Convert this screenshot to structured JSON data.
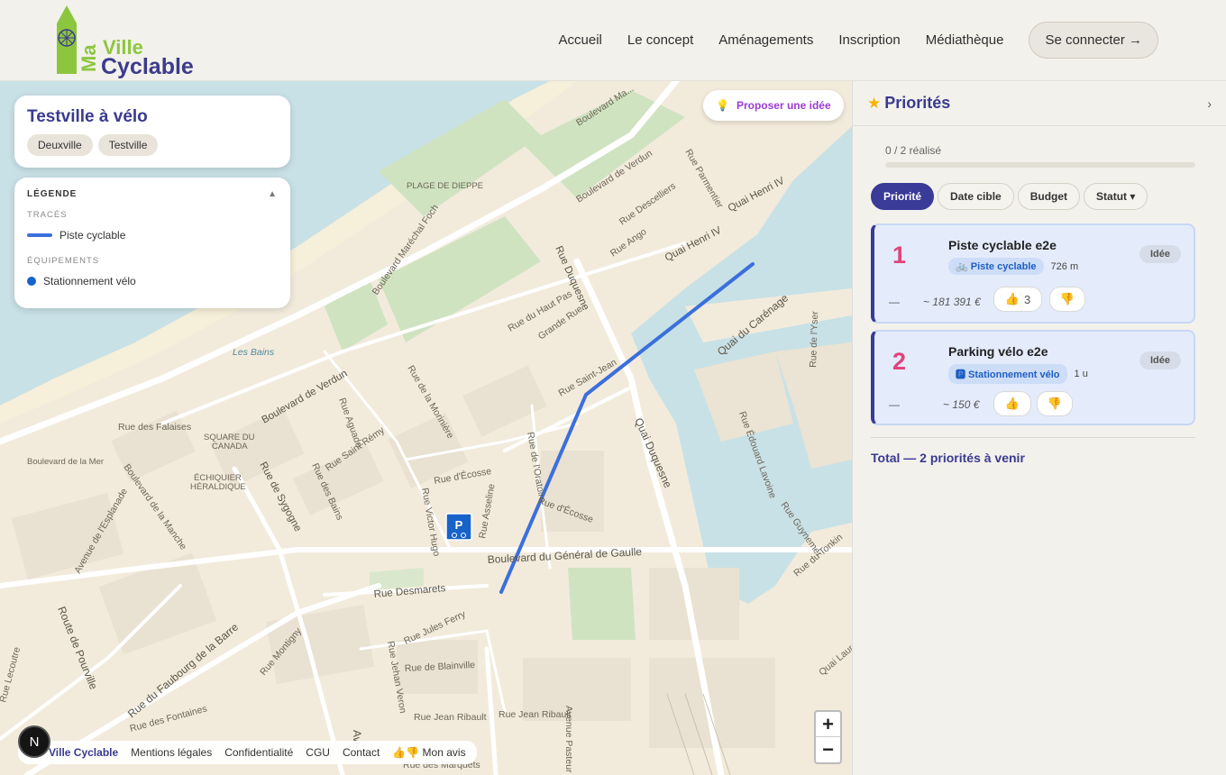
{
  "header": {
    "logo": {
      "ma": "Ma",
      "ville": "Ville",
      "cyclable": "Cyclable"
    },
    "nav": [
      "Accueil",
      "Le concept",
      "Aménagements",
      "Inscription",
      "Médiathèque"
    ],
    "connect_label": "Se connecter →"
  },
  "map": {
    "title": "Testville à vélo",
    "chips": [
      "Deuxville",
      "Testville"
    ],
    "legend": {
      "heading": "LÉGENDE",
      "toggle": "▲",
      "section_traces": "TRACÉS",
      "trace_label": "Piste cyclable",
      "section_equipements": "ÉQUIPEMENTS",
      "equipement_label": "Stationnement vélo"
    },
    "idea_button": "Proposer une idée",
    "labels": {
      "bd_maritime": "Boulevard Ma...",
      "bd_verdun_top": "Boulevard de Verdun",
      "bd_foch": "Boulevard Maréchal Foch",
      "plage": "PLAGE DE DIEPPE",
      "quai_henri": "Quai Henri IV",
      "quai_henri2": "Quai Henri IV",
      "rue_duquesne": "Rue Duquesne",
      "quai_duquesne": "Quai Duquesne",
      "quai_carenage": "Quai du Carénage",
      "bd_verdun": "Boulevard de Verdun",
      "les_bains": "Les Bains",
      "square": "SQUARE DU",
      "canada": "CANADA",
      "echiquier": "ÉCHIQUIER",
      "heraldique": "HÉRALDIQUE",
      "bd_mer": "Boulevard de la Mer",
      "rue_sygogne": "Rue de Sygogne",
      "rue_desmarets": "Rue Desmarets",
      "bd_gaulle": "Boulevard du Général de Gaulle",
      "route_pourville": "Route de Pourville",
      "rue_faubourg": "Rue du Faubourg de la Barre",
      "rue_ecosse": "Rue d'Écosse",
      "rue_ecosse2": "Rue d'Écosse",
      "grande_rue": "Grande Rue",
      "rue_haut_pas": "Rue du Haut Pas",
      "rue_saint_jean": "Rue Saint-Jean",
      "rue_saint_remy": "Rue Saint-Rémy",
      "rue_falaises": "Rue des Falaises",
      "rue_blainville": "Rue de Blainville",
      "rue_jean_ribault": "Rue Jean Ribault",
      "rue_jean_ribault2": "Rue Jean Ribault",
      "rue_tonkin": "Rue du Tonkin",
      "rue_parmentier": "Rue Parmentier",
      "rue_descelliers": "Rue Descelliers",
      "rue_ango": "Rue Ango",
      "quai_laure": "Quai Laure",
      "rue_victor_hugo": "Rue Victor Hugo",
      "rue_asseline": "Rue Asseline",
      "rue_aguado": "Rue Aguado",
      "rue_jules_ferry": "Rue Jules Ferry",
      "rue_jehan_veron": "Rue Jehan Veron",
      "rue_montigny": "Rue Montigny",
      "avenue_pasteur": "Avenue Pasteur",
      "rue_des_bains": "Rue des Bains",
      "rue_oratoire": "Rue de l'Oratoire",
      "rue_moriniere": "Rue de la Morinière",
      "rue_yser": "Rue de l'Yser",
      "rue_edouard_lavoine": "Rue Édouard Lavoine",
      "rue_guynemer": "Rue Guynemer",
      "bd_manche": "Boulevard de la Manche",
      "avenue_esplanade": "Avenue de l'Esplanade",
      "rue_fontaines": "Rue des Fontaines",
      "rue_marquets": "Rue des Marquets",
      "rue_lecoutre": "Rue Lecoutre",
      "ave_bottom": "Ave"
    },
    "parking_letter": "P",
    "zoom_in": "+",
    "zoom_out": "−"
  },
  "footer": {
    "badge": "N",
    "brand": "Ville Cyclable",
    "links": [
      "Mentions légales",
      "Confidentialité",
      "CGU",
      "Contact"
    ],
    "avis_emoji": "👍👎",
    "avis": "Mon avis"
  },
  "panel": {
    "title": "Priorités",
    "chevron": "›",
    "progress": "0 / 2 réalisé",
    "progress_fraction": 0,
    "sorts": [
      "Priorité",
      "Date cible",
      "Budget",
      "Statut ▾"
    ],
    "cards": [
      {
        "num": "1",
        "name": "Piste cyclable e2e",
        "tag": "🚲 Piste cyclable",
        "value": "726 m",
        "status": "Idée",
        "dash": "—",
        "cost": "~ 181 391 €",
        "up": "👍",
        "up_count": "3",
        "down": "👎"
      },
      {
        "num": "2",
        "name": "Parking vélo e2e",
        "tag": "🅿 Stationnement vélo",
        "value": "1 u",
        "status": "Idée",
        "dash": "—",
        "cost": "~ 150 €",
        "up": "👍",
        "up_count": "",
        "down": "👎"
      }
    ],
    "total": "Total — 2 priorités à venir"
  },
  "colors": {
    "accent": "#3a3a98",
    "route": "#3b6fdc",
    "water": "#c7e0e6",
    "priority_num": "#e0457b"
  }
}
